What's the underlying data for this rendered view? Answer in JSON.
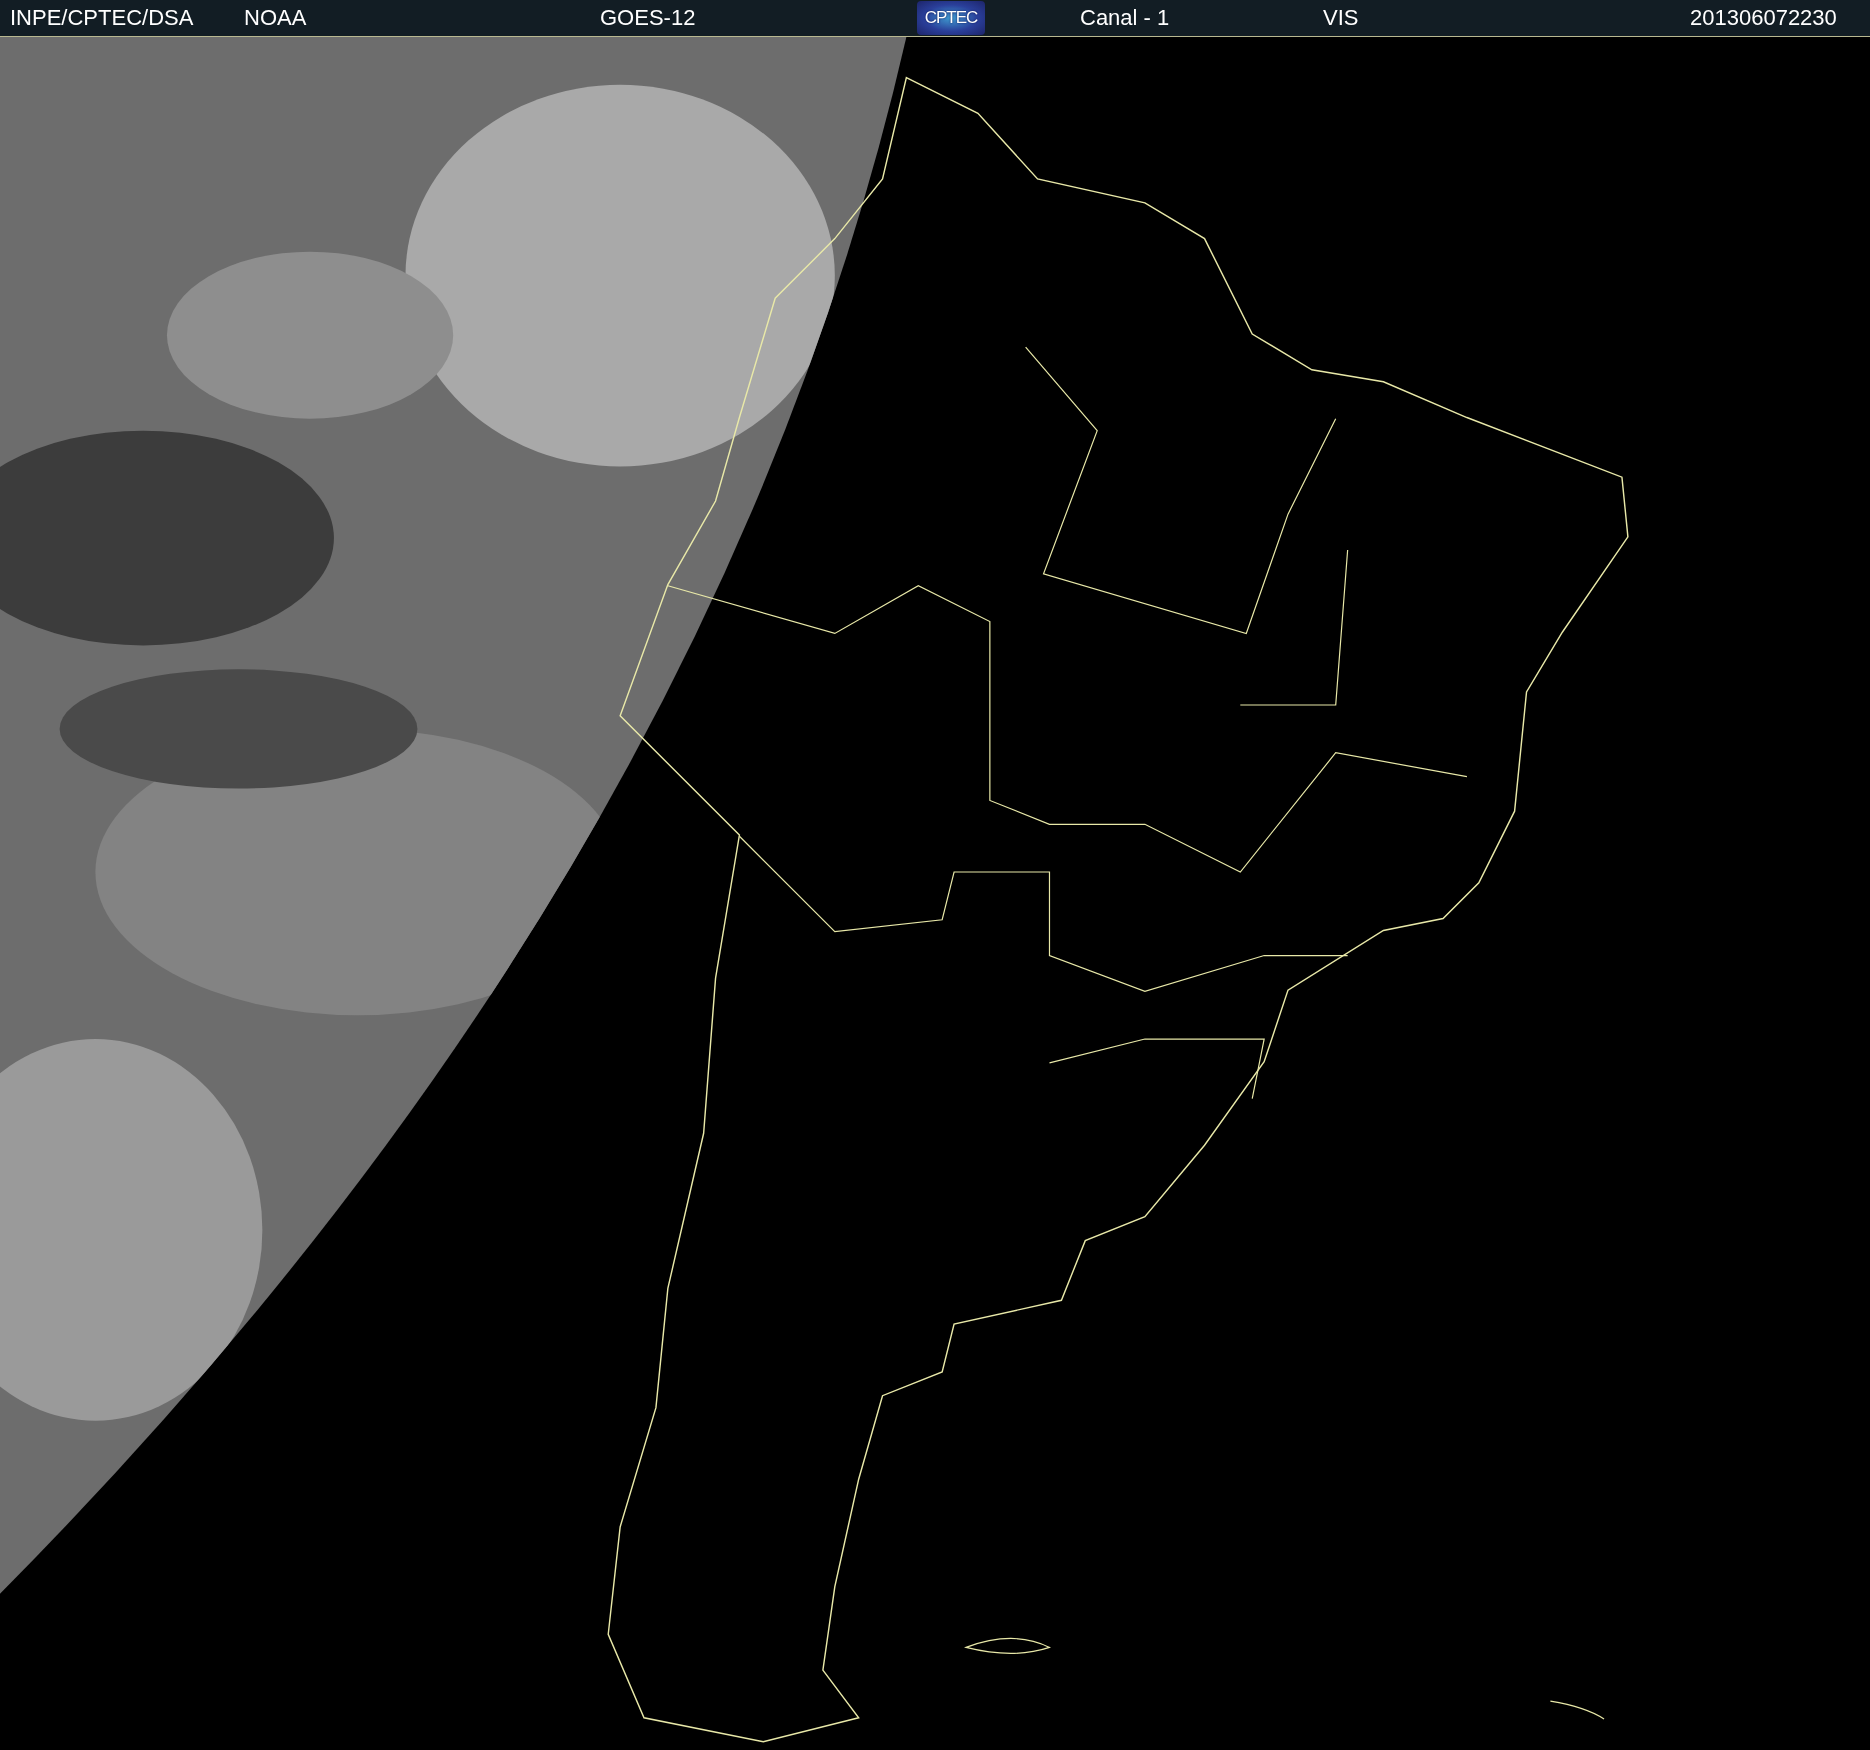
{
  "header": {
    "source": "INPE/CPTEC/DSA",
    "agency": "NOAA",
    "satellite": "GOES-12",
    "logo": {
      "text": "CPTEC"
    },
    "channel": "Canal - 1",
    "band": "VIS",
    "timestamp": "201306072230"
  }
}
